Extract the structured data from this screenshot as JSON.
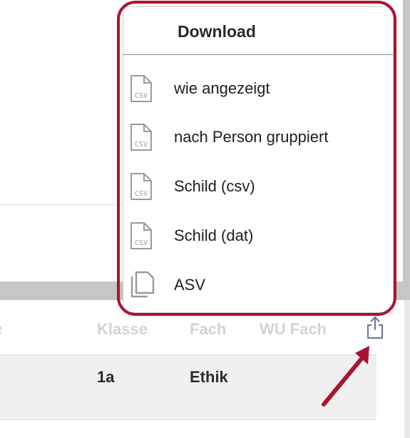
{
  "download_menu": {
    "title": "Download",
    "items": [
      {
        "label": "wie angezeigt",
        "icon": "csv-file-icon"
      },
      {
        "label": "nach Person gruppiert",
        "icon": "csv-file-icon"
      },
      {
        "label": "Schild (csv)",
        "icon": "csv-file-icon"
      },
      {
        "label": "Schild (dat)",
        "icon": "csv-file-icon"
      },
      {
        "label": "ASV",
        "icon": "copy-files-icon"
      }
    ],
    "icon_text": "CSV"
  },
  "table": {
    "headers": [
      "Klasse",
      "Fach",
      "WU Fach"
    ],
    "rows": [
      {
        "klasse": "1a",
        "fach": "Ethik",
        "wu_fach": ""
      }
    ]
  },
  "colors": {
    "highlight": "#a81530",
    "icon_gray": "#9a9a9a",
    "header_text": "#d3d3d3",
    "accent_icon": "#6b7f95"
  },
  "toolbar": {
    "export_icon": "share-export-icon"
  }
}
